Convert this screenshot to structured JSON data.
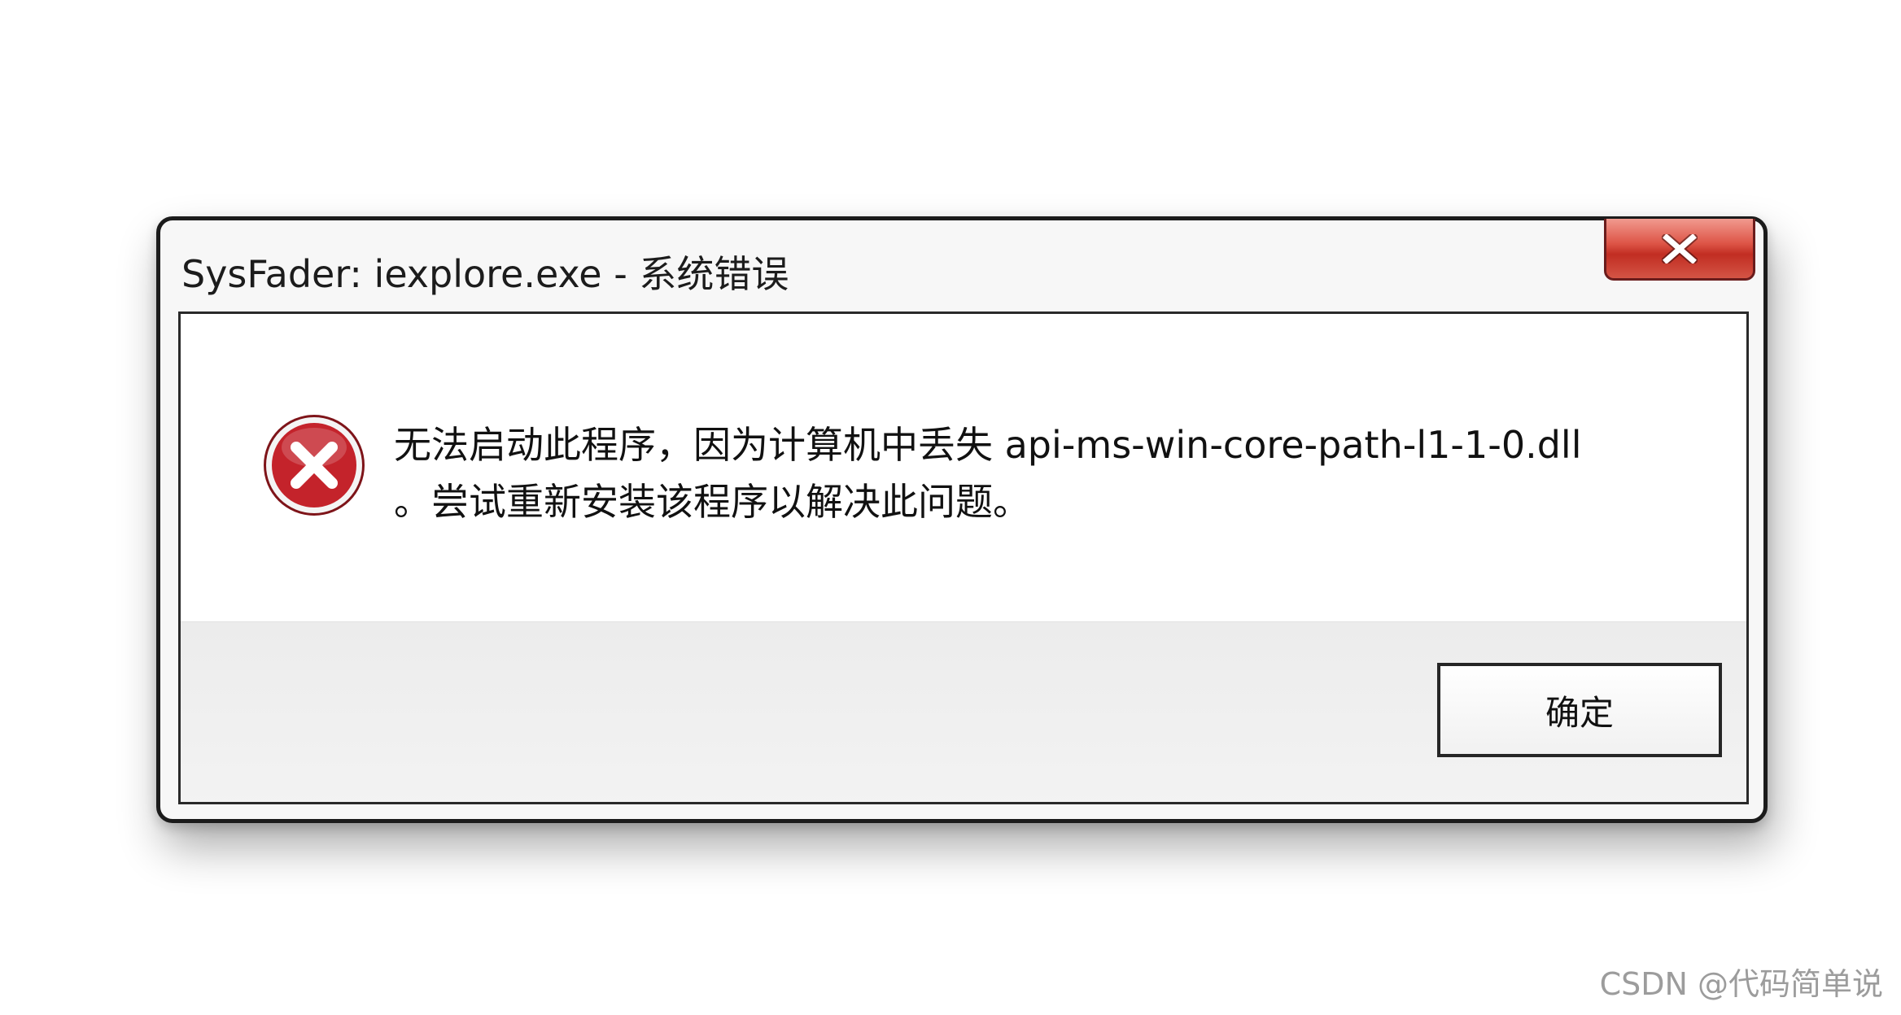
{
  "window": {
    "title": "SysFader: iexplore.exe - 系统错误",
    "close_icon": "close-icon"
  },
  "message": {
    "icon": "error-icon",
    "line1": "无法启动此程序，因为计算机中丢失 api-ms-win-core-path-l1-1-0.dll",
    "line2": "。尝试重新安装该程序以解决此问题。"
  },
  "buttons": {
    "ok_label": "确定"
  },
  "watermark": {
    "text": "CSDN @代码简单说"
  },
  "colors": {
    "close_button": "#d9483b",
    "error_icon": "#c4232b",
    "background": "#ffffff"
  }
}
